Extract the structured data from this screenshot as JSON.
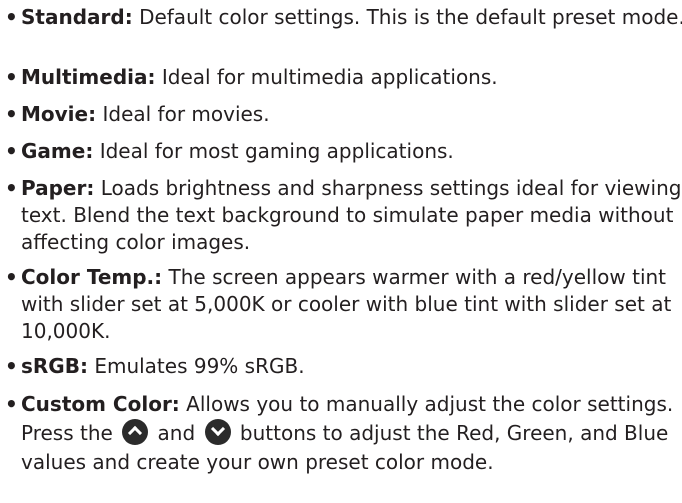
{
  "bullet": "•",
  "items": [
    {
      "term": "Standard:",
      "text": "Default color settings. This is the default preset mode."
    },
    {
      "term": "Multimedia:",
      "text": "Ideal for multimedia applications."
    },
    {
      "term": "Movie:",
      "text": "Ideal for movies."
    },
    {
      "term": "Game:",
      "text": "Ideal for most gaming applications."
    },
    {
      "term": "Paper:",
      "text": "Loads brightness and sharpness settings ideal for viewing text. Blend the text background to simulate paper media without affecting color images."
    },
    {
      "term": "Color Temp.:",
      "text": "The screen appears warmer with a red/yellow tint with slider set at 5,000K or cooler with blue tint with slider set at 10,000K."
    },
    {
      "term": "sRGB:",
      "text": "Emulates 99% sRGB."
    },
    {
      "term": "Custom Color:",
      "text_before": "Allows you to manually adjust the color settings. Press the",
      "text_middle": "and",
      "text_after": "buttons to adjust the Red, Green, and Blue values and create your own preset color mode.",
      "icon_up": "chevron-up-circle-icon",
      "icon_down": "chevron-down-circle-icon"
    }
  ]
}
